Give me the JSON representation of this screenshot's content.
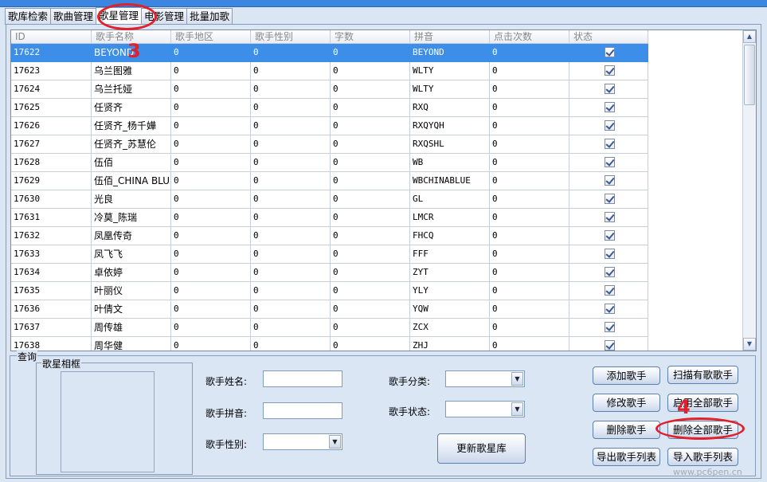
{
  "tabs": [
    {
      "label": "歌库检索"
    },
    {
      "label": "歌曲管理"
    },
    {
      "label": "歌星管理",
      "active": true
    },
    {
      "label": "电影管理"
    },
    {
      "label": "批量加歌"
    }
  ],
  "table": {
    "columns": [
      "ID",
      "歌手名称",
      "歌手地区",
      "歌手性别",
      "字数",
      "拼音",
      "点击次数",
      "状态"
    ],
    "rows": [
      {
        "id": "17622",
        "name": "BEYOND",
        "region": "0",
        "gender": "0",
        "chars": "0",
        "pinyin": "BEYOND",
        "clicks": "0",
        "status": true
      },
      {
        "id": "17623",
        "name": "乌兰图雅",
        "region": "0",
        "gender": "0",
        "chars": "0",
        "pinyin": "WLTY",
        "clicks": "0",
        "status": true
      },
      {
        "id": "17624",
        "name": "乌兰托娅",
        "region": "0",
        "gender": "0",
        "chars": "0",
        "pinyin": "WLTY",
        "clicks": "0",
        "status": true
      },
      {
        "id": "17625",
        "name": "任贤齐",
        "region": "0",
        "gender": "0",
        "chars": "0",
        "pinyin": "RXQ",
        "clicks": "0",
        "status": true
      },
      {
        "id": "17626",
        "name": "任贤齐_杨千嬅",
        "region": "0",
        "gender": "0",
        "chars": "0",
        "pinyin": "RXQYQH",
        "clicks": "0",
        "status": true
      },
      {
        "id": "17627",
        "name": "任贤齐_苏慧伦",
        "region": "0",
        "gender": "0",
        "chars": "0",
        "pinyin": "RXQSHL",
        "clicks": "0",
        "status": true
      },
      {
        "id": "17628",
        "name": "伍佰",
        "region": "0",
        "gender": "0",
        "chars": "0",
        "pinyin": "WB",
        "clicks": "0",
        "status": true
      },
      {
        "id": "17629",
        "name": "伍佰_CHINA BLUE",
        "region": "0",
        "gender": "0",
        "chars": "0",
        "pinyin": "WBCHINABLUE",
        "clicks": "0",
        "status": true
      },
      {
        "id": "17630",
        "name": "光良",
        "region": "0",
        "gender": "0",
        "chars": "0",
        "pinyin": "GL",
        "clicks": "0",
        "status": true
      },
      {
        "id": "17631",
        "name": "冷莫_陈瑞",
        "region": "0",
        "gender": "0",
        "chars": "0",
        "pinyin": "LMCR",
        "clicks": "0",
        "status": true
      },
      {
        "id": "17632",
        "name": "凤凰传奇",
        "region": "0",
        "gender": "0",
        "chars": "0",
        "pinyin": "FHCQ",
        "clicks": "0",
        "status": true
      },
      {
        "id": "17633",
        "name": "凤飞飞",
        "region": "0",
        "gender": "0",
        "chars": "0",
        "pinyin": "FFF",
        "clicks": "0",
        "status": true
      },
      {
        "id": "17634",
        "name": "卓依婷",
        "region": "0",
        "gender": "0",
        "chars": "0",
        "pinyin": "ZYT",
        "clicks": "0",
        "status": true
      },
      {
        "id": "17635",
        "name": "叶丽仪",
        "region": "0",
        "gender": "0",
        "chars": "0",
        "pinyin": "YLY",
        "clicks": "0",
        "status": true
      },
      {
        "id": "17636",
        "name": "叶倩文",
        "region": "0",
        "gender": "0",
        "chars": "0",
        "pinyin": "YQW",
        "clicks": "0",
        "status": true
      },
      {
        "id": "17637",
        "name": "周传雄",
        "region": "0",
        "gender": "0",
        "chars": "0",
        "pinyin": "ZCX",
        "clicks": "0",
        "status": true
      },
      {
        "id": "17638",
        "name": "周华健",
        "region": "0",
        "gender": "0",
        "chars": "0",
        "pinyin": "ZHJ",
        "clicks": "0",
        "status": true
      }
    ]
  },
  "query": {
    "legend": "查询",
    "photo_legend": "歌星相框",
    "name_label": "歌手姓名:",
    "name_value": "",
    "pinyin_label": "歌手拼音:",
    "pinyin_value": "",
    "gender_label": "歌手性别:",
    "gender_value": "",
    "category_label": "歌手分类:",
    "category_value": "",
    "status_label": "歌手状态:",
    "status_value": ""
  },
  "buttons": {
    "update_library": "更新歌星库",
    "add_singer": "添加歌手",
    "edit_singer": "修改歌手",
    "delete_singer": "删除歌手",
    "export_list": "导出歌手列表",
    "scan_singers": "扫描有歌歌手",
    "enable_all": "启用全部歌手",
    "delete_all": "删除全部歌手",
    "import_list": "导入歌手列表"
  },
  "annotations": {
    "step3": "3",
    "step4": "4"
  },
  "watermark": {
    "text": "www.pc6pen.cn"
  },
  "colors": {
    "selection": "#3d8ee8",
    "annotation": "#e0202a",
    "title_bar": "#3b86e0"
  }
}
